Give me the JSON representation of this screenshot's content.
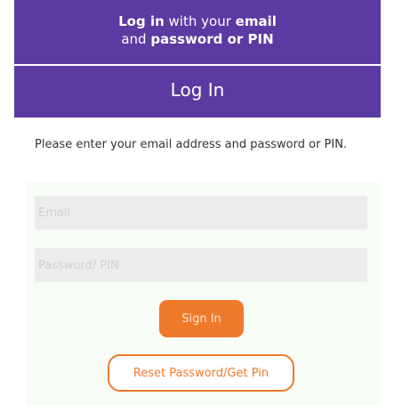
{
  "banner": {
    "headline_line1_bold": "Log in",
    "headline_line1_mid": " with your ",
    "headline_line1_bold2": "email",
    "headline_line2_plain": "and ",
    "headline_line2_bold": "password or PIN",
    "title": "Log In"
  },
  "form": {
    "instructions": "Please enter your email address and password or PIN.",
    "email": {
      "value": "",
      "placeholder": "Email"
    },
    "password": {
      "value": "",
      "placeholder": "Password/ PIN"
    },
    "signin_label": "Sign In",
    "reset_label": "Reset Password/Get Pin"
  },
  "colors": {
    "banner": "#5b3aa1",
    "accent": "#ee7a2a",
    "field_background": "#ececec",
    "form_background": "#f8fcf7"
  }
}
